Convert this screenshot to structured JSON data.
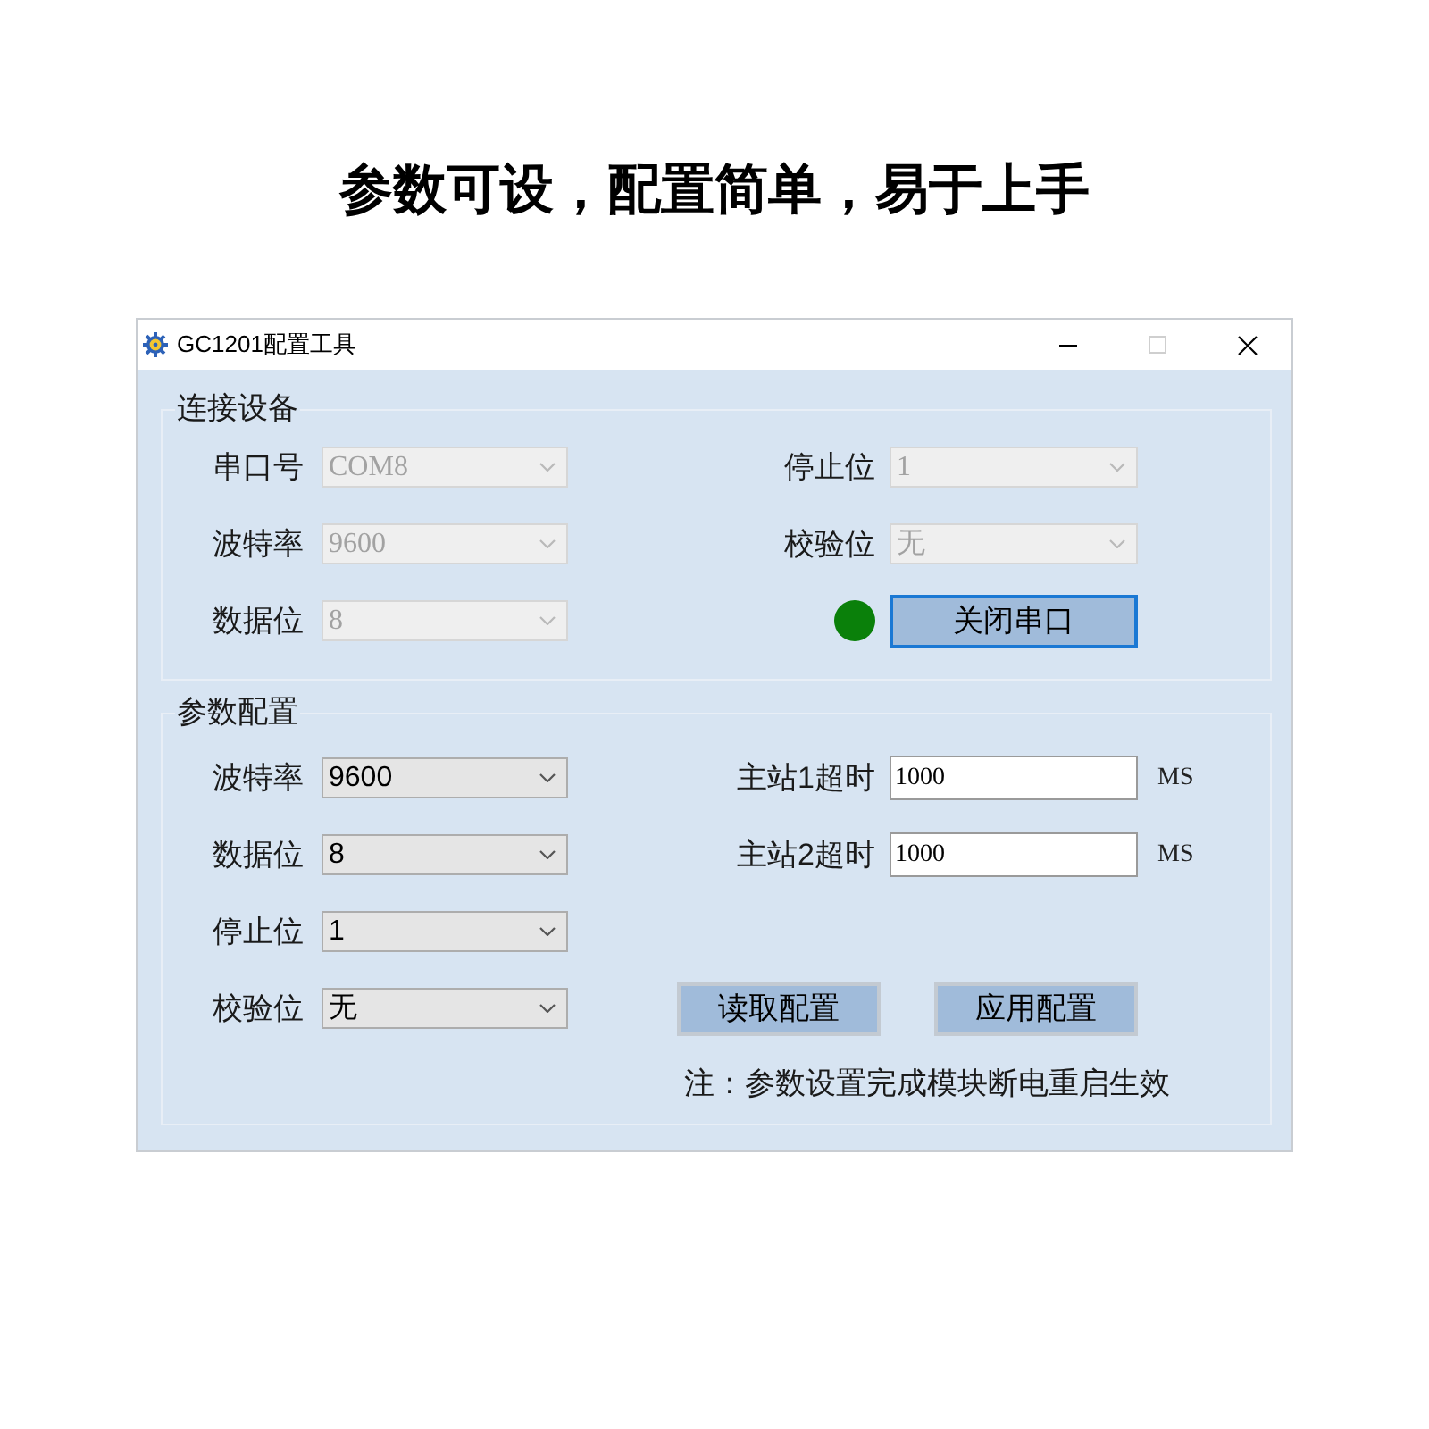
{
  "headline": "参数可设，配置简单，易于上手",
  "window": {
    "title": "GC1201配置工具",
    "maximize_disabled": true
  },
  "groups": [
    {
      "title": "连接设备",
      "left": [
        {
          "kind": "combo",
          "label": "串口号",
          "value": "COM8",
          "disabled": true
        },
        {
          "kind": "combo",
          "label": "波特率",
          "value": "9600",
          "disabled": true
        },
        {
          "kind": "combo",
          "label": "数据位",
          "value": "8",
          "disabled": true
        }
      ],
      "right": [
        {
          "kind": "combo",
          "label": "停止位",
          "value": "1",
          "disabled": true
        },
        {
          "kind": "combo",
          "label": "校验位",
          "value": "无",
          "disabled": true
        },
        {
          "kind": "status_button",
          "connected": true,
          "button": {
            "label": "关闭串口",
            "focused": true
          }
        }
      ]
    },
    {
      "title": "参数配置",
      "left": [
        {
          "kind": "combo",
          "label": "波特率",
          "value": "9600",
          "disabled": false
        },
        {
          "kind": "combo",
          "label": "数据位",
          "value": "8",
          "disabled": false
        },
        {
          "kind": "combo",
          "label": "停止位",
          "value": "1",
          "disabled": false
        },
        {
          "kind": "combo",
          "label": "校验位",
          "value": "无",
          "disabled": false
        }
      ],
      "right": [
        {
          "kind": "text",
          "label": "主站1超时",
          "value": "1000",
          "unit": "MS"
        },
        {
          "kind": "text",
          "label": "主站2超时",
          "value": "1000",
          "unit": "MS"
        },
        {
          "kind": "buttons",
          "buttons": [
            {
              "label": "读取配置",
              "focused": false
            },
            {
              "label": "应用配置",
              "focused": false
            }
          ]
        }
      ],
      "note": "注：参数设置完成模块断电重启生效"
    }
  ]
}
